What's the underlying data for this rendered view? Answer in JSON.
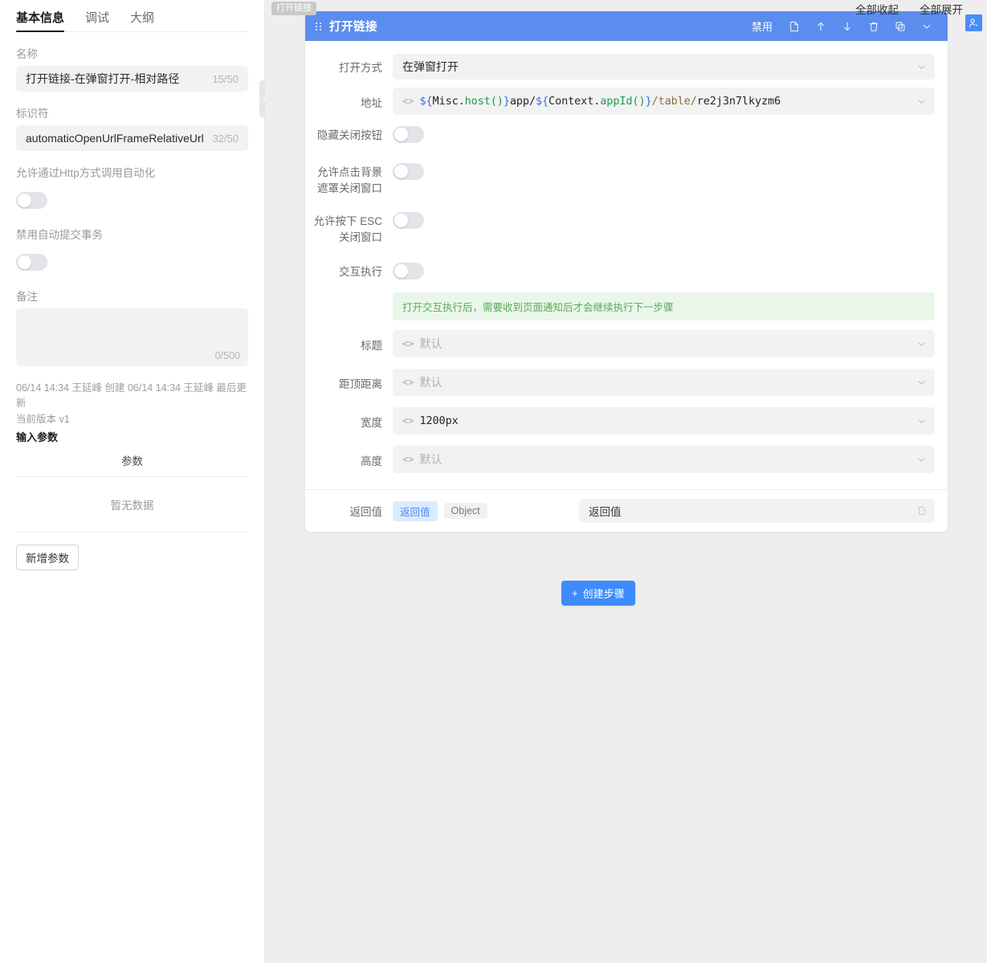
{
  "sidebar": {
    "tabs": [
      {
        "label": "基本信息",
        "active": true
      },
      {
        "label": "调试",
        "active": false
      },
      {
        "label": "大纲",
        "active": false
      }
    ],
    "name_field": {
      "label": "名称",
      "value": "打开链接-在弹窗打开-相对路径",
      "count": "15/50"
    },
    "ident_field": {
      "label": "标识符",
      "value": "automaticOpenUrlFrameRelativeUrl",
      "count": "32/50"
    },
    "http_toggle": {
      "label": "允许通过Http方式调用自动化",
      "state": "off"
    },
    "disable_auto_commit_toggle": {
      "label": "禁用自动提交事务",
      "state": "off"
    },
    "remark": {
      "label": "备注",
      "value": "",
      "count": "0/500"
    },
    "meta": {
      "line1": "06/14 14:34 王延峰 创建 06/14 14:34 王延峰 最后更新",
      "line2": "当前版本 v1"
    },
    "input_params": {
      "section_title": "输入参数",
      "column_header": "参数",
      "empty_text": "暂无数据",
      "add_button": "新增参数"
    },
    "collapse_handle_icon": "triangle-left-icon"
  },
  "topbar": {
    "collapse_all": "全部收起",
    "expand_all": "全部展开",
    "avatar_icon": "user-add-icon"
  },
  "canvas": {
    "node_tag": "打开链接",
    "create_step_button": "创建步骤",
    "create_step_icon": "plus-icon"
  },
  "card": {
    "drag_handle_icon": "drag-dots-icon",
    "title": "打开链接",
    "toolbar": {
      "disable_label": "禁用",
      "icons": [
        {
          "name": "note-icon"
        },
        {
          "name": "arrow-up-icon"
        },
        {
          "name": "arrow-down-icon"
        },
        {
          "name": "trash-icon"
        },
        {
          "name": "copy-icon"
        },
        {
          "name": "chevron-down-icon"
        }
      ]
    },
    "fields": [
      {
        "key": "open_mode",
        "label": "打开方式",
        "type": "select",
        "value": "在弹窗打开",
        "has_code_mark": false,
        "chevron": "chevron-down-icon"
      },
      {
        "key": "address",
        "label": "地址",
        "type": "code-select",
        "has_code_mark": true,
        "code_mark": "<>",
        "tokens": [
          {
            "t": "${",
            "c": "brace"
          },
          {
            "t": "Misc.",
            "c": "name"
          },
          {
            "t": "host()",
            "c": "fn"
          },
          {
            "t": "}",
            "c": "brace"
          },
          {
            "t": "app/",
            "c": "plain"
          },
          {
            "t": "${",
            "c": "brace"
          },
          {
            "t": "Context.",
            "c": "name"
          },
          {
            "t": "appId()",
            "c": "fn"
          },
          {
            "t": "}",
            "c": "brace"
          },
          {
            "t": "/table/",
            "c": "path"
          },
          {
            "t": "re2j3n7lkyzm6",
            "c": "plain"
          }
        ],
        "plain_value": "${Misc.host()}app/${Context.appId()}/table/re2j3n7lkyzm6",
        "chevron": "chevron-down-icon"
      },
      {
        "key": "hide_close_button",
        "label": "隐藏关闭按钮",
        "type": "toggle",
        "state": "off"
      },
      {
        "key": "mask_click_close",
        "label": "允许点击背景\n遮罩关闭窗口",
        "type": "toggle",
        "state": "off"
      },
      {
        "key": "esc_close",
        "label": "允许按下 ESC\n关闭窗口",
        "type": "toggle",
        "state": "off"
      },
      {
        "key": "interactive_exec",
        "label": "交互执行",
        "type": "toggle-with-hint",
        "state": "off",
        "hint": "打开交互执行后，需要收到页面通知后才会继续执行下一步骤"
      },
      {
        "key": "title",
        "label": "标题",
        "type": "code-select",
        "has_code_mark": true,
        "code_mark": "<>",
        "placeholder": "默认",
        "value": "",
        "chevron": "chevron-down-icon"
      },
      {
        "key": "top_distance",
        "label": "距顶距离",
        "type": "code-select",
        "has_code_mark": true,
        "code_mark": "<>",
        "placeholder": "默认",
        "value": "",
        "chevron": "chevron-down-icon"
      },
      {
        "key": "width",
        "label": "宽度",
        "type": "code-select",
        "has_code_mark": true,
        "code_mark": "<>",
        "placeholder": "默认",
        "value": "1200px",
        "chevron": "chevron-down-icon"
      },
      {
        "key": "height",
        "label": "高度",
        "type": "code-select",
        "has_code_mark": true,
        "code_mark": "<>",
        "placeholder": "默认",
        "value": "",
        "chevron": "chevron-down-icon"
      }
    ],
    "footer": {
      "label": "返回值",
      "chip_active": "返回值",
      "chip_type": "Object",
      "input_value": "返回值",
      "input_icon": "copy-icon"
    }
  },
  "colors": {
    "accent_blue": "#5b8def",
    "button_blue": "#3d8bfd",
    "canvas_bg": "#eeeeee",
    "field_bg": "#f2f2f3",
    "hint_green_bg": "#eaf6ea",
    "hint_green_text": "#5aa95a"
  }
}
